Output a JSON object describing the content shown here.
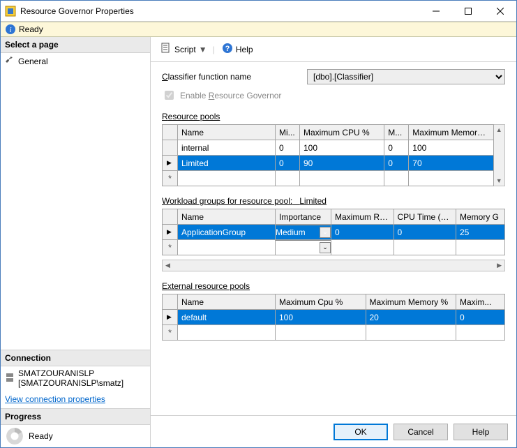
{
  "window": {
    "title": "Resource Governor Properties"
  },
  "readybar": {
    "text": "Ready"
  },
  "sidebar": {
    "select_page": "Select a page",
    "general": "General",
    "connection_head": "Connection",
    "server": "SMATZOURANISLP",
    "user": "[SMATZOURANISLP\\smatz]",
    "view_conn": "View connection properties",
    "progress_head": "Progress",
    "progress_text": "Ready"
  },
  "toolbar": {
    "script": "Script",
    "help": "Help"
  },
  "form": {
    "classifier_label_pre": "",
    "classifier_label": "Classifier function name",
    "classifier_value": "[dbo].[Classifier]",
    "enable_label_pre": "Enable ",
    "enable_label_und": "R",
    "enable_label_post": "esource Governor"
  },
  "pools": {
    "label_und": "R",
    "label_post": "esource pools",
    "cols": [
      "Name",
      "Mi...",
      "Maximum CPU %",
      "M...",
      "Maximum Memory %"
    ],
    "rows": [
      {
        "name": "internal",
        "min_cpu": "0",
        "max_cpu": "100",
        "min_mem": "0",
        "max_mem": "100",
        "selected": false
      },
      {
        "name": "Limited",
        "min_cpu": "0",
        "max_cpu": "90",
        "min_mem": "0",
        "max_mem": "70",
        "selected": true
      }
    ]
  },
  "workload": {
    "label_und": "W",
    "label_post": "orkload groups for resource pool:",
    "pool_name": "Limited",
    "cols": [
      "Name",
      "Importance",
      "Maximum Req...",
      "CPU Time (sec)",
      "Memory G"
    ],
    "rows": [
      {
        "name": "ApplicationGroup",
        "importance": "Medium",
        "max_req": "0",
        "cpu_time": "0",
        "mem": "25",
        "selected": true
      }
    ]
  },
  "external": {
    "label_pre": "E",
    "label_und": "x",
    "label_post": "ternal resource pools",
    "cols": [
      "Name",
      "Maximum Cpu %",
      "Maximum Memory %",
      "Maxim..."
    ],
    "rows": [
      {
        "name": "default",
        "max_cpu": "100",
        "max_mem": "20",
        "max": "0",
        "selected": true
      }
    ]
  },
  "footer": {
    "ok": "OK",
    "cancel": "Cancel",
    "help": "Help"
  }
}
